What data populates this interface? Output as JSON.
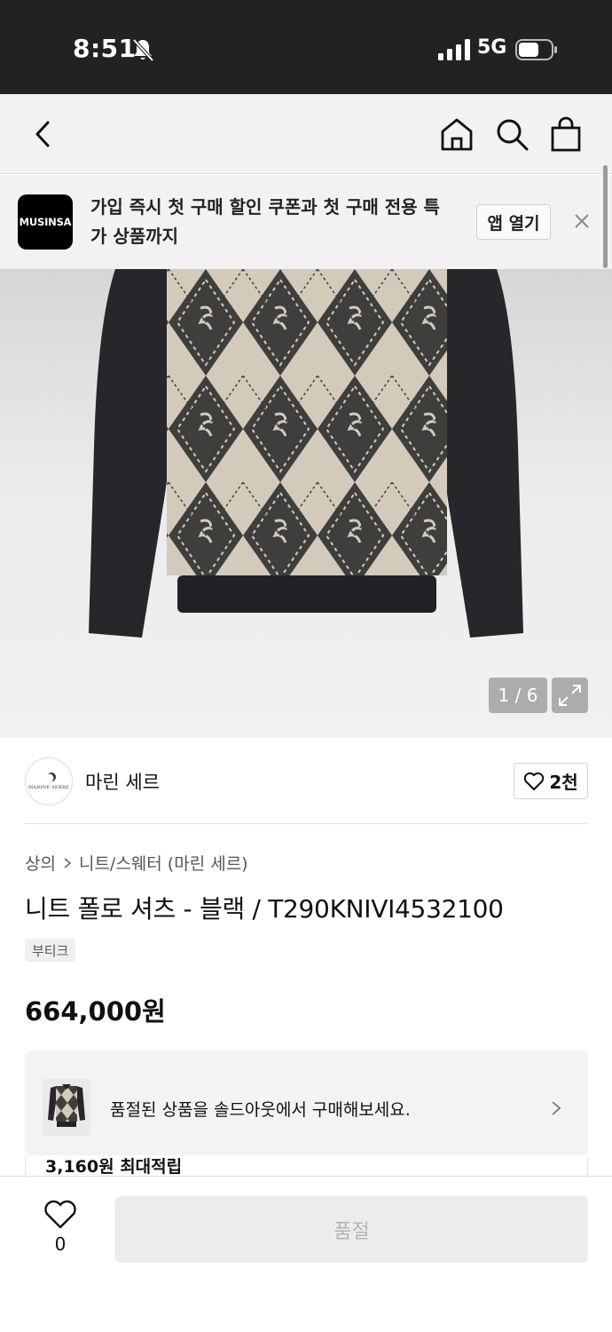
{
  "status_bar": {
    "time": "8:51",
    "network": "5G",
    "icons": [
      "bell-muted-icon",
      "signal-icon",
      "battery-icon"
    ]
  },
  "nav": {
    "icons": [
      "back-arrow-icon",
      "home-icon",
      "search-icon",
      "shopping-bag-icon"
    ]
  },
  "app_banner": {
    "logo_text": "MUSINSA",
    "message": "가입 즉시 첫 구매 할인 쿠폰과 첫 구매 전용 특가 상품까지",
    "open_label": "앱 열기",
    "close_icon": "close-icon"
  },
  "product_image": {
    "counter": "1 / 6",
    "expand_icon": "expand-icon"
  },
  "brand": {
    "name": "마린 세르",
    "logo_text": "MARINE SERRE",
    "like_count": "2천"
  },
  "product": {
    "breadcrumb": [
      "상의",
      "니트/스웨터 (마린 세르)"
    ],
    "title": "니트 폴로 셔츠 - 블랙 / T290KNIVI4532100",
    "tag": "부티크",
    "price": "664,000원"
  },
  "soldout_card": {
    "message": "품절된 상품을 솔드아웃에서 구매해보세요."
  },
  "points": {
    "text": "3,160원 최대적립"
  },
  "bottom_bar": {
    "like_count": "0",
    "buy_label": "품절"
  },
  "colors": {
    "status_bg": "#222222",
    "header_bg": "#f2f2f2",
    "disabled_btn": "#ececec",
    "disabled_text": "#b3b3b3"
  }
}
